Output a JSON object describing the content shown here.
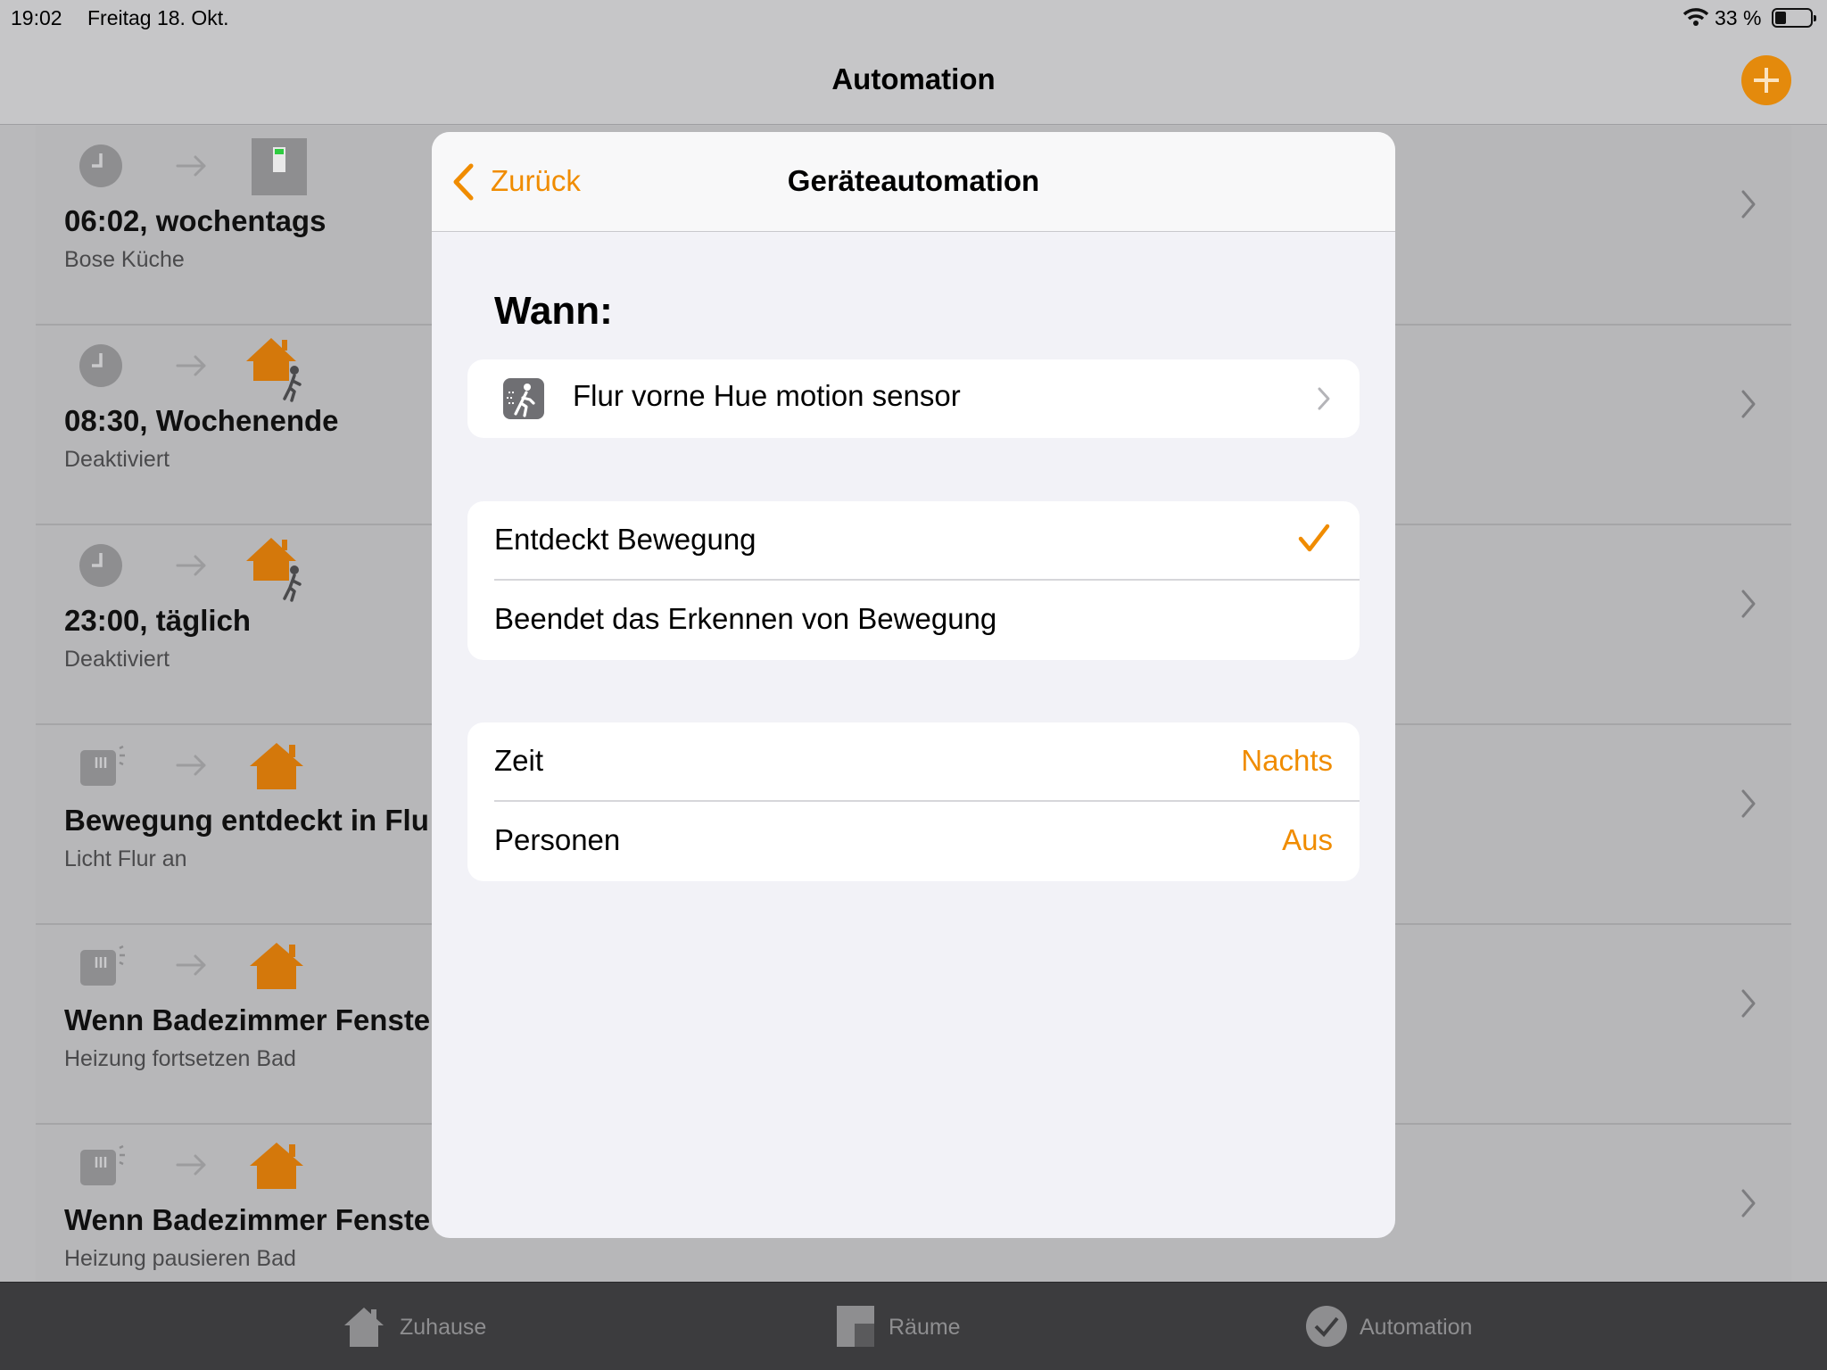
{
  "status_bar": {
    "time": "19:02",
    "date": "Freitag 18. Okt.",
    "battery_percent": "33 %",
    "icons": [
      "wifi-icon",
      "battery-icon"
    ]
  },
  "nav": {
    "title": "Automation",
    "add_icon": "plus-icon"
  },
  "automations": [
    {
      "title": "06:02, wochentags",
      "subtitle": "Bose Küche",
      "trigger_icon": "clock-icon",
      "target_icon": "speaker-icon"
    },
    {
      "title": "08:30, Wochenende",
      "subtitle": "Deaktiviert",
      "trigger_icon": "clock-icon",
      "target_icon": "home-person-icon"
    },
    {
      "title": "23:00, täglich",
      "subtitle": "Deaktiviert",
      "trigger_icon": "clock-icon",
      "target_icon": "home-person-icon"
    },
    {
      "title": "Bewegung entdeckt in Flu",
      "subtitle": "Licht Flur an",
      "trigger_icon": "sensor-icon",
      "target_icon": "home-icon"
    },
    {
      "title": "Wenn Badezimmer Fenste",
      "subtitle": "Heizung fortsetzen Bad",
      "trigger_icon": "sensor-icon",
      "target_icon": "home-icon"
    },
    {
      "title": "Wenn Badezimmer Fenste",
      "subtitle": "Heizung pausieren Bad",
      "trigger_icon": "sensor-icon",
      "target_icon": "home-icon"
    }
  ],
  "modal": {
    "back_label": "Zurück",
    "title": "Geräteautomation",
    "section_title": "Wann:",
    "device": {
      "label": "Flur vorne Hue motion sensor",
      "icon": "motion-sensor-icon"
    },
    "motion_options": [
      {
        "label": "Entdeckt Bewegung",
        "selected": true
      },
      {
        "label": "Beendet das Erkennen von Bewegung",
        "selected": false
      }
    ],
    "conditions": [
      {
        "label": "Zeit",
        "value": "Nachts"
      },
      {
        "label": "Personen",
        "value": "Aus"
      }
    ]
  },
  "tabbar": {
    "tabs": [
      {
        "label": "Zuhause",
        "icon": "home-tab-icon"
      },
      {
        "label": "Räume",
        "icon": "rooms-tab-icon"
      },
      {
        "label": "Automation",
        "icon": "automation-tab-icon",
        "active": true
      }
    ]
  },
  "colors": {
    "accent": "#f08c00",
    "home_icon": "#e48a0c",
    "modal_bg": "#f2f2f7"
  }
}
